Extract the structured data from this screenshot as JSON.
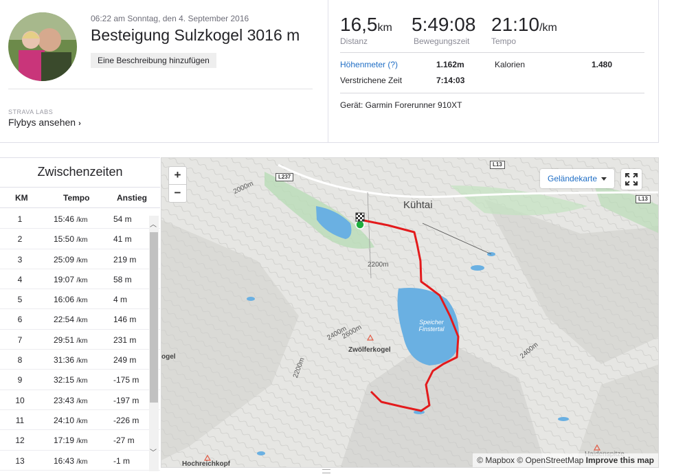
{
  "header": {
    "date": "06:22 am Sonntag, den 4. September 2016",
    "title": "Besteigung Sulzkogel 3016 m",
    "add_description": "Eine Beschreibung hinzufügen",
    "labs_label": "STRAVA LABS",
    "flybys_label": "Flybys ansehen"
  },
  "stats": {
    "distance": {
      "value": "16,5",
      "unit": "km",
      "label": "Distanz"
    },
    "moving_time": {
      "value": "5:49:08",
      "label": "Bewegungszeit"
    },
    "pace": {
      "value": "21:10",
      "unit": "/km",
      "label": "Tempo"
    },
    "elevation_label": "Höhenmeter (?)",
    "elevation_value": "1.162m",
    "calories_label": "Kalorien",
    "calories_value": "1.480",
    "elapsed_label": "Verstrichene Zeit",
    "elapsed_value": "7:14:03",
    "device": "Gerät: Garmin Forerunner 910XT"
  },
  "splits": {
    "title": "Zwischenzeiten",
    "headers": {
      "km": "KM",
      "pace": "Tempo",
      "gain": "Anstieg"
    },
    "rows": [
      {
        "km": "1",
        "pace": "15:46",
        "unit": "/km",
        "gain": "54 m"
      },
      {
        "km": "2",
        "pace": "15:50",
        "unit": "/km",
        "gain": "41 m"
      },
      {
        "km": "3",
        "pace": "25:09",
        "unit": "/km",
        "gain": "219 m"
      },
      {
        "km": "4",
        "pace": "19:07",
        "unit": "/km",
        "gain": "58 m"
      },
      {
        "km": "5",
        "pace": "16:06",
        "unit": "/km",
        "gain": "4 m"
      },
      {
        "km": "6",
        "pace": "22:54",
        "unit": "/km",
        "gain": "146 m"
      },
      {
        "km": "7",
        "pace": "29:51",
        "unit": "/km",
        "gain": "231 m"
      },
      {
        "km": "8",
        "pace": "31:36",
        "unit": "/km",
        "gain": "249 m"
      },
      {
        "km": "9",
        "pace": "32:15",
        "unit": "/km",
        "gain": "-175 m"
      },
      {
        "km": "10",
        "pace": "23:43",
        "unit": "/km",
        "gain": "-197 m"
      },
      {
        "km": "11",
        "pace": "24:10",
        "unit": "/km",
        "gain": "-226 m"
      },
      {
        "km": "12",
        "pace": "17:19",
        "unit": "/km",
        "gain": "-27 m"
      },
      {
        "km": "13",
        "pace": "16:43",
        "unit": "/km",
        "gain": "-1 m"
      }
    ]
  },
  "map": {
    "zoom_in": "+",
    "zoom_out": "−",
    "layer_select": "Geländekarte",
    "attribution_mapbox": "© Mapbox",
    "attribution_osm": "© OpenStreetMap",
    "attribution_improve": "Improve this map",
    "labels": {
      "town": "Kühtai",
      "lake": "Speicher Finstertal",
      "peak1": "Zwölferkogel",
      "peak2": "Hochreichkopf",
      "left_edge": "ogel",
      "road1": "L237",
      "road2": "L13",
      "road3": "L13",
      "contour1": "2000m",
      "contour2": "2200m",
      "contour3": "2400m",
      "contour4": "2600m",
      "contour5": "2400m",
      "contour6": "2200m",
      "peak3": "Haidenspitze"
    }
  },
  "colors": {
    "link": "#1e6dc5",
    "route": "#e31a1c",
    "water": "#6ab0e2",
    "forest": "#b5dcb3"
  }
}
